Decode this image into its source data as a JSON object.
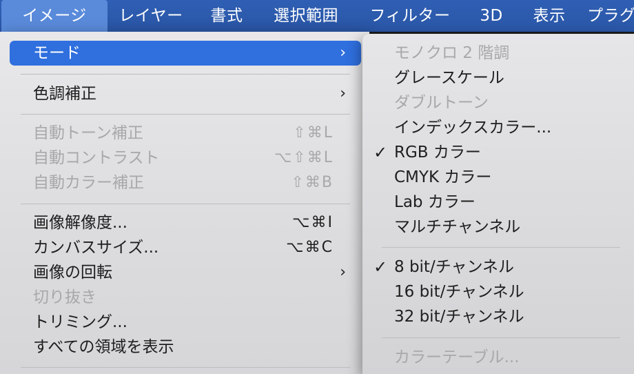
{
  "menubar": {
    "items": [
      {
        "label": "イメージ",
        "active": true
      },
      {
        "label": "レイヤー"
      },
      {
        "label": "書式"
      },
      {
        "label": "選択範囲"
      },
      {
        "label": "フィルター"
      },
      {
        "label": "3D"
      },
      {
        "label": "表示"
      },
      {
        "label": "プラグ"
      }
    ]
  },
  "image_menu": {
    "items": [
      {
        "label": "モード",
        "arrow": "›",
        "highlighted": true
      },
      {
        "label": "色調補正",
        "arrow": "›"
      },
      {
        "label": "自動トーン補正",
        "shortcut": "⇧⌘L",
        "disabled": true
      },
      {
        "label": "自動コントラスト",
        "shortcut": "⌥⇧⌘L",
        "disabled": true
      },
      {
        "label": "自動カラー補正",
        "shortcut": "⇧⌘B",
        "disabled": true
      },
      {
        "label": "画像解像度...",
        "shortcut": "⌥⌘I"
      },
      {
        "label": "カンバスサイズ...",
        "shortcut": "⌥⌘C"
      },
      {
        "label": "画像の回転",
        "arrow": "›"
      },
      {
        "label": "切り抜き",
        "disabled": true
      },
      {
        "label": "トリミング..."
      },
      {
        "label": "すべての領域を表示"
      }
    ]
  },
  "mode_submenu": {
    "check_glyph": "✓",
    "items": [
      {
        "label": "モノクロ 2 階調",
        "disabled": true
      },
      {
        "label": "グレースケール"
      },
      {
        "label": "ダブルトーン",
        "disabled": true
      },
      {
        "label": "インデックスカラー..."
      },
      {
        "label": "RGB カラー",
        "checked": true
      },
      {
        "label": "CMYK カラー"
      },
      {
        "label": "Lab カラー"
      },
      {
        "label": "マルチチャンネル"
      },
      {
        "label": "8 bit/チャンネル",
        "checked": true
      },
      {
        "label": "16 bit/チャンネル"
      },
      {
        "label": "32 bit/チャンネル"
      },
      {
        "label": "カラーテーブル...",
        "disabled": true
      }
    ]
  },
  "colors": {
    "menubar": "#2f5fb4",
    "menubar_active": "#5a8bdb",
    "highlight": "#2f6fde",
    "disabled_text": "#a8a8aa"
  }
}
